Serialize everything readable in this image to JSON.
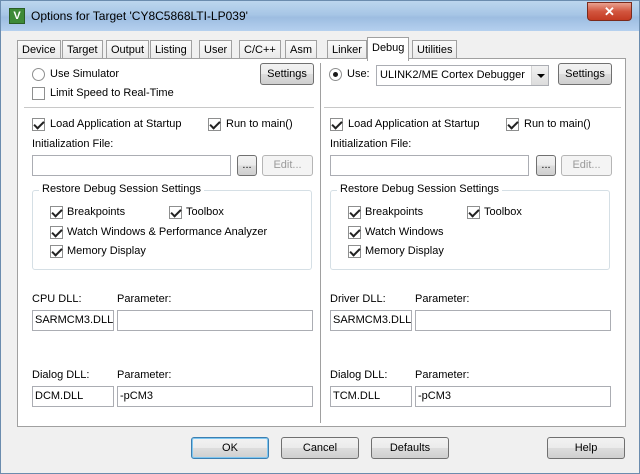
{
  "window": {
    "title": "Options for Target 'CY8C5868LTI-LP039'",
    "close_glyph": "✕",
    "icon_letter": "V"
  },
  "tabs": [
    "Device",
    "Target",
    "Output",
    "Listing",
    "User",
    "C/C++",
    "Asm",
    "Linker",
    "Debug",
    "Utilities"
  ],
  "active_tab": "Debug",
  "left": {
    "use_simulator": "Use Simulator",
    "use_simulator_checked": false,
    "limit_speed": "Limit Speed to Real-Time",
    "limit_speed_checked": false,
    "settings": "Settings",
    "load_app": "Load Application at Startup",
    "load_app_checked": true,
    "run_to_main": "Run to main()",
    "run_to_main_checked": true,
    "init_file_label": "Initialization File:",
    "init_file_value": "",
    "browse": "...",
    "edit": "Edit...",
    "restore_title": "Restore Debug Session Settings",
    "breakpoints": "Breakpoints",
    "toolbox": "Toolbox",
    "watch": "Watch Windows & Performance Analyzer",
    "memory": "Memory Display",
    "cpu_dll_label": "CPU DLL:",
    "cpu_dll_value": "SARMCM3.DLL",
    "cpu_param_label": "Parameter:",
    "cpu_param_value": "",
    "dialog_dll_label": "Dialog DLL:",
    "dialog_dll_value": "DCM.DLL",
    "dialog_param_label": "Parameter:",
    "dialog_param_value": "-pCM3"
  },
  "right": {
    "use": "Use:",
    "use_checked": true,
    "debugger": "ULINK2/ME Cortex Debugger",
    "settings": "Settings",
    "load_app": "Load Application at Startup",
    "load_app_checked": true,
    "run_to_main": "Run to main()",
    "run_to_main_checked": true,
    "init_file_label": "Initialization File:",
    "init_file_value": "",
    "browse": "...",
    "edit": "Edit...",
    "restore_title": "Restore Debug Session Settings",
    "breakpoints": "Breakpoints",
    "toolbox": "Toolbox",
    "watch": "Watch Windows",
    "memory": "Memory Display",
    "driver_dll_label": "Driver DLL:",
    "driver_dll_value": "SARMCM3.DLL",
    "driver_param_label": "Parameter:",
    "driver_param_value": "",
    "dialog_dll_label": "Dialog DLL:",
    "dialog_dll_value": "TCM.DLL",
    "dialog_param_label": "Parameter:",
    "dialog_param_value": "-pCM3"
  },
  "buttons": {
    "ok": "OK",
    "cancel": "Cancel",
    "defaults": "Defaults",
    "help": "Help"
  }
}
